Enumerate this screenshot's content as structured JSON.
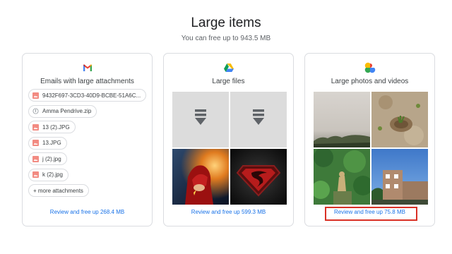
{
  "header": {
    "title": "Large items",
    "subtitle": "You can free up to 943.5 MB"
  },
  "gmail": {
    "icon": "gmail-icon",
    "title": "Emails with large attachments",
    "attachments": [
      {
        "name": "9432F697-3CD3-40D9-BCBE-51A6C...",
        "icon": "image-icon"
      },
      {
        "name": "Amma Pendrive.zip",
        "icon": "zip-icon"
      },
      {
        "name": "13 (2).JPG",
        "icon": "image-icon"
      },
      {
        "name": "13.JPG",
        "icon": "image-icon"
      },
      {
        "name": "j (2).jpg",
        "icon": "image-icon"
      },
      {
        "name": "k (2).jpg",
        "icon": "image-icon"
      }
    ],
    "more_label": "+ more attachments",
    "review_label": "Review and free up 268.4 MB"
  },
  "drive": {
    "icon": "google-drive-icon",
    "title": "Large files",
    "review_label": "Review and free up 599.3 MB"
  },
  "photos": {
    "icon": "google-photos-icon",
    "title": "Large photos and videos",
    "review_label": "Review and free up 75.8 MB"
  },
  "colors": {
    "link": "#1a73e8",
    "highlight": "#d93025"
  }
}
